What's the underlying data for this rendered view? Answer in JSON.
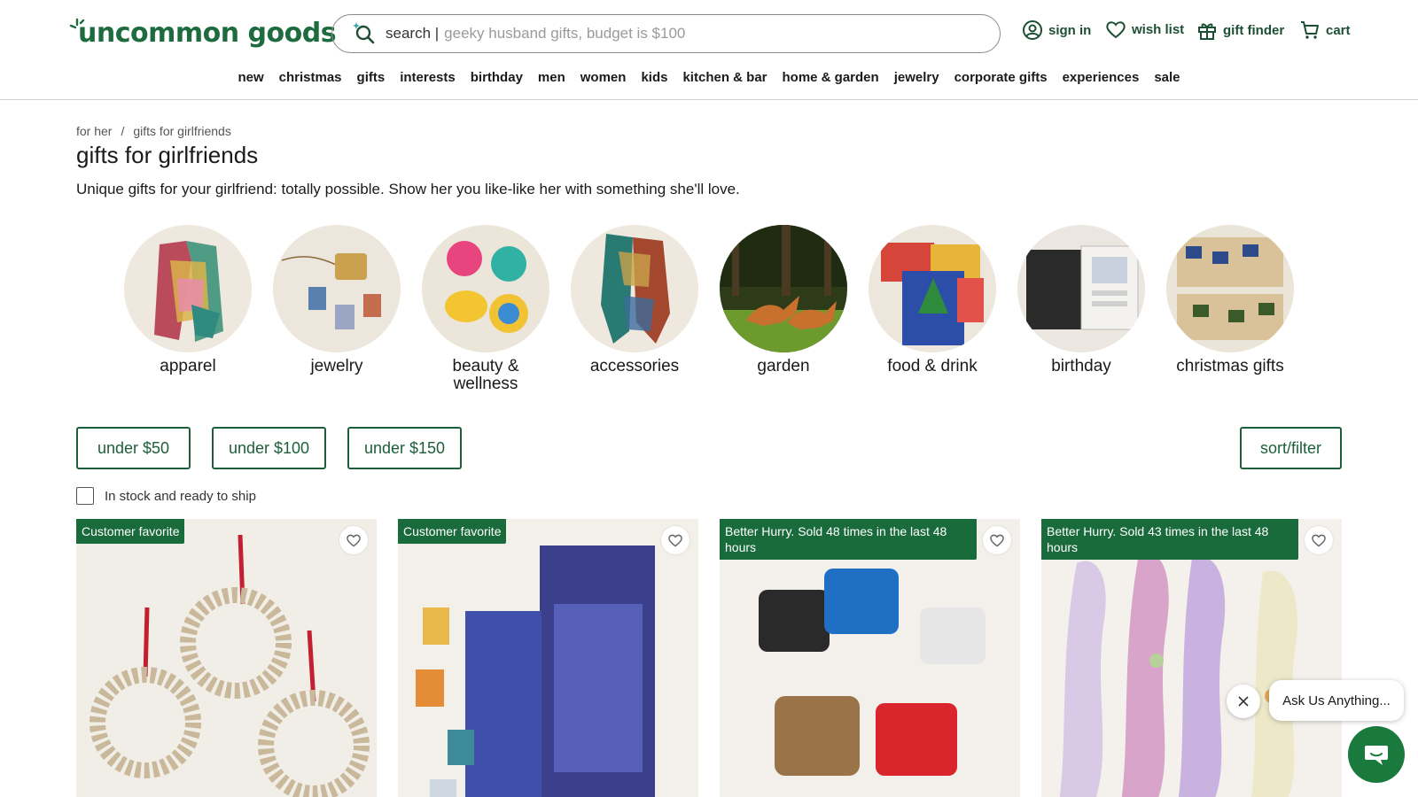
{
  "brand": {
    "name": "uncommon goods",
    "color": "#1d6b3f"
  },
  "search": {
    "label": "search |",
    "placeholder": "geeky husband gifts, budget is $100"
  },
  "util": {
    "sign_in": "sign in",
    "wish_list": "wish list",
    "gift_finder": "gift finder",
    "cart": "cart"
  },
  "nav": [
    "new",
    "christmas",
    "gifts",
    "interests",
    "birthday",
    "men",
    "women",
    "kids",
    "kitchen & bar",
    "home & garden",
    "jewelry",
    "corporate gifts",
    "experiences",
    "sale"
  ],
  "breadcrumb": {
    "parent": "for her",
    "sep": "/",
    "current": "gifts for girlfriends"
  },
  "page": {
    "title": "gifts for girlfriends",
    "description": "Unique gifts for your girlfriend: totally possible. Show her you like-like her with something she'll love."
  },
  "categories": [
    {
      "label": "apparel"
    },
    {
      "label": "jewelry"
    },
    {
      "label": "beauty & wellness"
    },
    {
      "label": "accessories"
    },
    {
      "label": "garden"
    },
    {
      "label": "food & drink"
    },
    {
      "label": "birthday"
    },
    {
      "label": "christmas gifts"
    }
  ],
  "filters": {
    "under50": "under $50",
    "under100": "under $100",
    "under150": "under $150",
    "sort": "sort/filter"
  },
  "stock_filter": "In stock and ready to ship",
  "products": [
    {
      "badge": "Customer favorite"
    },
    {
      "badge": "Customer favorite"
    },
    {
      "badge": "Better Hurry. Sold 48 times in the last 48 hours"
    },
    {
      "badge": "Better Hurry. Sold 43 times in the last 48 hours"
    }
  ],
  "chat": {
    "prompt": "Ask Us Anything..."
  },
  "colors": {
    "accent": "#1d5e3a",
    "badge_bg": "#1a6b3c",
    "chat_bg": "#1a7a3e"
  }
}
